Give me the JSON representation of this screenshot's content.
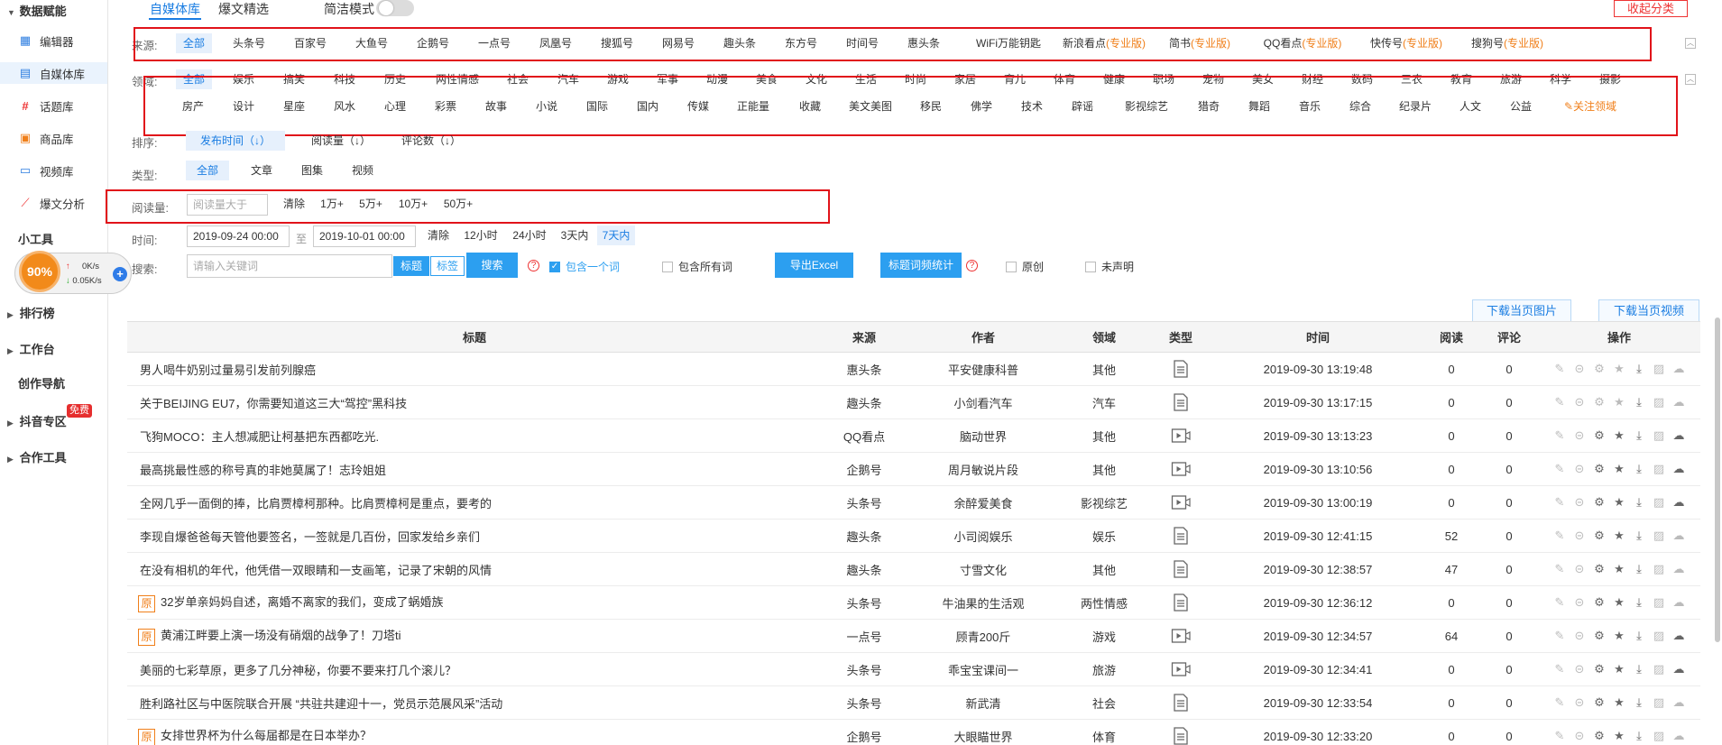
{
  "sidebar": {
    "group_data": "数据赋能",
    "items": [
      {
        "label": "编辑器",
        "icon": "grid-icon"
      },
      {
        "label": "自媒体库",
        "icon": "document-icon"
      },
      {
        "label": "话题库",
        "icon": "hash-icon"
      },
      {
        "label": "商品库",
        "icon": "shop-icon"
      },
      {
        "label": "视频库",
        "icon": "monitor-icon"
      },
      {
        "label": "爆文分析",
        "icon": "chart-line-icon"
      }
    ],
    "tools_heading": "小工具",
    "groups": [
      "排行榜",
      "工作台"
    ],
    "creation_nav": "创作导航",
    "douyin": "抖音专区",
    "free_badge": "免费",
    "coop": "合作工具"
  },
  "widget": {
    "percent": "90%",
    "up": "0K/s",
    "down": "0.05K/s",
    "plus": "+"
  },
  "tabs": [
    "自媒体库",
    "爆文精选"
  ],
  "simple_mode": "简洁模式",
  "collapse_btn": "收起分类",
  "source": {
    "label": "来源:",
    "items": [
      "全部",
      "头条号",
      "百家号",
      "大鱼号",
      "企鹅号",
      "一点号",
      "凤凰号",
      "搜狐号",
      "网易号",
      "趣头条",
      "东方号",
      "时间号",
      "惠头条",
      "WiFi万能钥匙"
    ],
    "pro_items": [
      [
        "新浪看点",
        "(专业版)"
      ],
      [
        "简书",
        "(专业版)"
      ],
      [
        "QQ看点",
        "(专业版)"
      ],
      [
        "快传号",
        "(专业版)"
      ],
      [
        "搜狗号",
        "(专业版)"
      ]
    ]
  },
  "domain": {
    "label": "领域:",
    "row1": [
      "全部",
      "娱乐",
      "搞笑",
      "科技",
      "历史",
      "两性情感",
      "社会",
      "汽车",
      "游戏",
      "军事",
      "动漫",
      "美食",
      "文化",
      "生活",
      "时尚",
      "家居",
      "育儿",
      "体育",
      "健康",
      "职场",
      "宠物",
      "美女",
      "财经",
      "数码",
      "三农",
      "教育",
      "旅游",
      "科学",
      "摄影"
    ],
    "row2": [
      "房产",
      "设计",
      "星座",
      "风水",
      "心理",
      "彩票",
      "故事",
      "小说",
      "国际",
      "国内",
      "传媒",
      "正能量",
      "收藏",
      "美文美图",
      "移民",
      "佛学",
      "技术",
      "辟谣",
      "影视综艺",
      "猎奇",
      "舞蹈",
      "音乐",
      "综合",
      "纪录片",
      "人文",
      "公益"
    ],
    "follow": "关注领域"
  },
  "sort": {
    "label": "排序:",
    "items": [
      "发布时间（↓）",
      "阅读量（↓）",
      "评论数（↓）"
    ]
  },
  "type": {
    "label": "类型:",
    "items": [
      "全部",
      "文章",
      "图集",
      "视频"
    ]
  },
  "reads": {
    "label": "阅读量:",
    "placeholder": "阅读量大于",
    "items": [
      "清除",
      "1万+",
      "5万+",
      "10万+",
      "50万+"
    ]
  },
  "time": {
    "label": "时间:",
    "start": "2019-09-24 00:00",
    "to": "至",
    "end": "2019-10-01 00:00",
    "items": [
      "清除",
      "12小时",
      "24小时",
      "3天内",
      "7天内"
    ]
  },
  "search": {
    "label": "搜索:",
    "placeholder": "请输入关键词",
    "mode_title": "标题",
    "mode_tag": "标签",
    "button": "搜索",
    "contain_one": "包含一个词",
    "contain_all": "包含所有词",
    "export": "导出Excel",
    "stats": "标题词频统计",
    "original": "原创",
    "undeclared": "未声明"
  },
  "downloads": {
    "images": "下载当页图片",
    "videos": "下载当页视频"
  },
  "table": {
    "headers": [
      "标题",
      "来源",
      "作者",
      "领域",
      "类型",
      "时间",
      "阅读",
      "评论",
      "操作"
    ],
    "rows": [
      {
        "title": "男人喝牛奶别过量易引发前列腺癌",
        "orig": "",
        "source": "惠头条",
        "author": "平安健康科普",
        "domain": "其他",
        "type": "article",
        "time": "2019-09-30 13:19:48",
        "reads": "0",
        "comments": "0"
      },
      {
        "title": "关于BEIJING EU7，你需要知道这三大“驾控”黑科技",
        "orig": "",
        "source": "趣头条",
        "author": "小剑看汽车",
        "domain": "汽车",
        "type": "article",
        "time": "2019-09-30 13:17:15",
        "reads": "0",
        "comments": "0"
      },
      {
        "title": "飞狗MOCO：主人想减肥让柯基把东西都吃光.",
        "orig": "",
        "source": "QQ看点",
        "author": "脑动世界",
        "domain": "其他",
        "type": "video",
        "time": "2019-09-30 13:13:23",
        "reads": "0",
        "comments": "0"
      },
      {
        "title": "最高挑最性感的称号真的非她莫属了！志玲姐姐",
        "orig": "",
        "source": "企鹅号",
        "author": "周月敏说片段",
        "domain": "其他",
        "type": "video",
        "time": "2019-09-30 13:10:56",
        "reads": "0",
        "comments": "0"
      },
      {
        "title": "全网几乎一面倒的捧，比肩贾樟柯那种。比肩贾樟柯是重点，要考的",
        "orig": "",
        "source": "头条号",
        "author": "余醉爱美食",
        "domain": "影视综艺",
        "type": "video",
        "time": "2019-09-30 13:00:19",
        "reads": "0",
        "comments": "0"
      },
      {
        "title": "李现自爆爸爸每天管他要签名，一签就是几百份，回家发给乡亲们",
        "orig": "",
        "source": "趣头条",
        "author": "小司阅娱乐",
        "domain": "娱乐",
        "type": "article",
        "time": "2019-09-30 12:41:15",
        "reads": "52",
        "comments": "0"
      },
      {
        "title": "在没有相机的年代，他凭借一双眼睛和一支画笔，记录了宋朝的风情",
        "orig": "",
        "source": "趣头条",
        "author": "寸雪文化",
        "domain": "其他",
        "type": "article",
        "time": "2019-09-30 12:38:57",
        "reads": "47",
        "comments": "0"
      },
      {
        "title": "32岁单亲妈妈自述，离婚不离家的我们，变成了蜗婚族",
        "orig": "原",
        "source": "头条号",
        "author": "牛油果的生活观",
        "domain": "两性情感",
        "type": "article",
        "time": "2019-09-30 12:36:12",
        "reads": "0",
        "comments": "0"
      },
      {
        "title": "黄浦江畔要上演一场没有硝烟的战争了！刀塔ti",
        "orig": "原",
        "source": "一点号",
        "author": "顾青200斤",
        "domain": "游戏",
        "type": "video",
        "time": "2019-09-30 12:34:57",
        "reads": "64",
        "comments": "0"
      },
      {
        "title": "美丽的七彩草原，更多了几分神秘，你要不要来打几个滚儿？",
        "orig": "",
        "source": "头条号",
        "author": "乖宝宝课间一",
        "domain": "旅游",
        "type": "video",
        "time": "2019-09-30 12:34:41",
        "reads": "0",
        "comments": "0"
      },
      {
        "title": "胜利路社区与中医院联合开展 “共驻共建迎十一，党员示范展风采”活动",
        "orig": "",
        "source": "头条号",
        "author": "新武清",
        "domain": "社会",
        "type": "article",
        "time": "2019-09-30 12:33:54",
        "reads": "0",
        "comments": "0"
      },
      {
        "title": "女排世界杯为什么每届都是在日本举办？",
        "orig": "原",
        "source": "企鹅号",
        "author": "大眼瞄世界",
        "domain": "体育",
        "type": "article",
        "time": "2019-09-30 12:33:20",
        "reads": "0",
        "comments": "0"
      }
    ]
  }
}
